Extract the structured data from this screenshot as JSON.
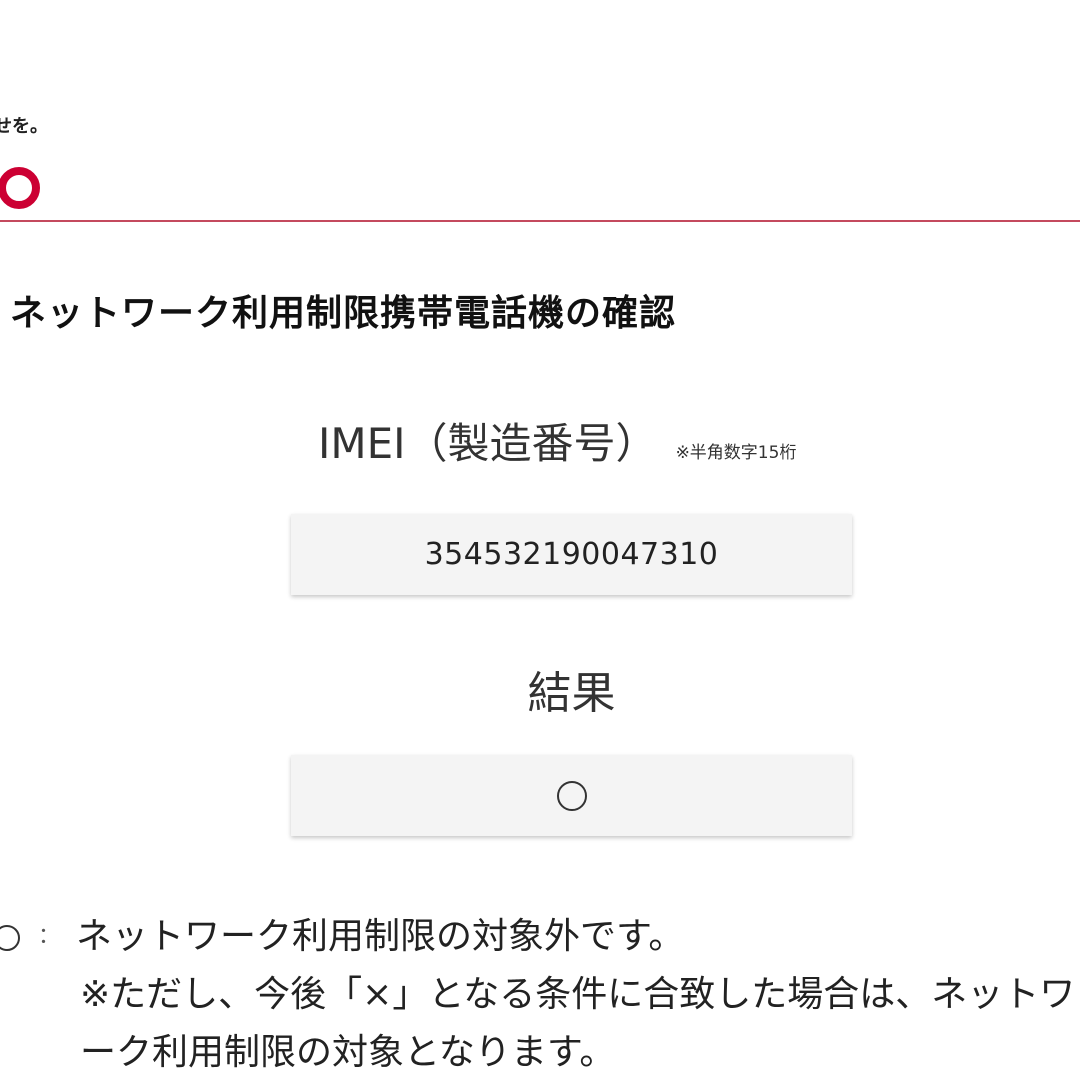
{
  "header": {
    "tagline": "せを。"
  },
  "page_title": "ネットワーク利用制限携帯電話機の確認",
  "imei": {
    "label": "IMEI（製造番号）",
    "note": "※半角数字15桁",
    "value": "354532190047310"
  },
  "result": {
    "label": "結果",
    "value_symbol": "circle-symbol"
  },
  "legend": {
    "symbol": "circle-symbol",
    "colon": "：",
    "text": "ネットワーク利用制限の対象外です。",
    "note": "※ただし、今後「×」となる条件に合致した場合は、ネットワーク利用制限の対象となります。"
  },
  "colors": {
    "brand_red": "#cc0033",
    "header_rule": "#c44a5e",
    "box_bg": "#f4f4f4"
  }
}
